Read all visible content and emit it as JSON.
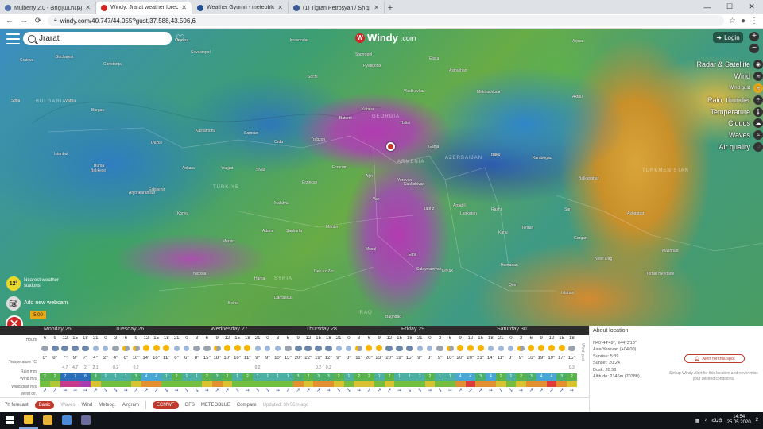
{
  "browser": {
    "tabs": [
      {
        "title": "Mulberry 2.0 - Յոցլաւություն",
        "color": "#5470a8",
        "active": false
      },
      {
        "title": "Windy: Jrarat weather forecast",
        "color": "#d02323",
        "active": true
      },
      {
        "title": "Weather Gyumri - meteoblue",
        "color": "#1e4e8c",
        "active": false
      },
      {
        "title": "(1) Tigran Petrosyan / Տիգրան",
        "color": "#3b5998",
        "active": false
      }
    ],
    "new_tab": "+",
    "url": "windy.com/40.747/44.055?gust,37.588,43.506,6"
  },
  "map": {
    "search_value": "Jrarat",
    "brand": "Windy",
    "brand_suffix": ".com",
    "login_label": "Login",
    "zoom_in": "+",
    "zoom_out": "−",
    "layers": [
      {
        "label": "Radar & Satellite",
        "selected": false,
        "small": false
      },
      {
        "label": "Wind",
        "selected": false,
        "small": false
      },
      {
        "label": "Wind gust",
        "selected": true,
        "small": true
      },
      {
        "label": "Rain, thunder",
        "selected": false,
        "small": false
      },
      {
        "label": "Temperature",
        "selected": false,
        "small": false
      },
      {
        "label": "Clouds",
        "selected": false,
        "small": false
      },
      {
        "label": "Waves",
        "selected": false,
        "small": false
      },
      {
        "label": "Air quality",
        "selected": false,
        "small": false
      }
    ],
    "countries": [
      {
        "name": "GEORGIA"
      },
      {
        "name": "AZERBAIJAN"
      },
      {
        "name": "TÜRKIYE"
      },
      {
        "name": "SYRIA"
      },
      {
        "name": "IRAQ"
      },
      {
        "name": "TURKMENISTAN"
      },
      {
        "name": "BULGARIA"
      },
      {
        "name": "ARMENIA"
      }
    ],
    "places": [
      "Craiova",
      "Bucharest",
      "Constanța",
      "Odessa",
      "Sevastopol",
      "Krasnodar",
      "Stavropol",
      "Elista",
      "Astrakhan",
      "Atyrau",
      "Sofia",
      "Varna",
      "Burgas",
      "Sochi",
      "Vladikavkaz",
      "Pyatigorsk",
      "Makhachkala",
      "Aktau",
      "Kutaisi",
      "Tbilisi",
      "Ganja",
      "Baku",
      "Istanbul",
      "Bursa",
      "Balıkesir",
      "Düzce",
      "Kastamonu",
      "Samsun",
      "Ordu",
      "Trabzon",
      "Batumi",
      "Yozgat",
      "Sivas",
      "Ankara",
      "Eskişehir",
      "Erzurum",
      "Ağrı",
      "Yerevan",
      "Erzincan",
      "Nakhchivan",
      "Lankaran",
      "Afyonkarahisar",
      "Konya",
      "Malatya",
      "Van",
      "Tabriz",
      "Ardabil",
      "Rasht",
      "Tehran",
      "Karaj",
      "Sari",
      "Mersin",
      "Adana",
      "Şanlıurfa",
      "Mardin",
      "Mosul",
      "Erbil",
      "Sulaymaniyah",
      "Kirkuk",
      "Hamadan",
      "Qom",
      "Nicosia",
      "Hama",
      "Deir ez-Zor",
      "Beirut",
      "Damascus",
      "Baghdad",
      "Isfahan",
      "Ashgabat",
      "Balkanabat",
      "Gorgan",
      "Mashhad",
      "Nebit Dag",
      "Karabogaz",
      "Torbat Heydarie"
    ],
    "temp_badge": "12°",
    "stations_label": "Nearest weather stations",
    "webcam_label": "Add new webcam",
    "time_badge": "5:00"
  },
  "forecast": {
    "days": [
      "Monday 25",
      "Tuesday 26",
      "Wednesday 27",
      "Thursday 28",
      "Friday 29",
      "Saturday 30"
    ],
    "row_labels": [
      "Hours",
      "Temperature",
      "Rain",
      "Wind",
      "Wind gust",
      "Wind dir."
    ],
    "units": [
      "",
      "°C",
      "mm",
      "m/s",
      "m/s",
      ""
    ],
    "scroll_label": "Wind gust",
    "hours": [
      "6",
      "9",
      "12",
      "15",
      "18",
      "21",
      "0",
      "3",
      "6",
      "9",
      "12",
      "15",
      "18",
      "21",
      "0",
      "3",
      "6",
      "9",
      "12",
      "15",
      "18",
      "21",
      "0",
      "3",
      "6",
      "9",
      "12",
      "15",
      "18",
      "21",
      "0",
      "3",
      "6",
      "9",
      "12",
      "15",
      "18",
      "21",
      "0",
      "3",
      "6",
      "9",
      "12",
      "15",
      "18",
      "21",
      "0",
      "3",
      "6",
      "9",
      "12",
      "15",
      "18"
    ],
    "icons": [
      "cloud",
      "rain",
      "rain",
      "rain",
      "rain",
      "moon",
      "moon",
      "cloud",
      "pc",
      "pc",
      "sun",
      "sun",
      "sun",
      "moon",
      "moon",
      "cloud",
      "cloud",
      "pc",
      "sun",
      "sun",
      "sun",
      "moon",
      "moon",
      "moon",
      "cloud",
      "rain",
      "rain",
      "rain",
      "rain",
      "moon",
      "moon",
      "pc",
      "sun",
      "sun",
      "rain",
      "rain",
      "rain",
      "moon",
      "moon",
      "cloud",
      "pc",
      "sun",
      "sun",
      "sun",
      "moon",
      "moon",
      "moon",
      "pc",
      "sun",
      "sun",
      "sun",
      "sun",
      "cloud"
    ],
    "temps": [
      "6°",
      "8°",
      "7°",
      "9°",
      "7°",
      "4°",
      "2°",
      "4°",
      "6°",
      "10°",
      "14°",
      "16°",
      "11°",
      "6°",
      "6°",
      "8°",
      "15°",
      "18°",
      "18°",
      "16°",
      "11°",
      "9°",
      "9°",
      "10°",
      "15°",
      "20°",
      "22°",
      "19°",
      "12°",
      "9°",
      "8°",
      "11°",
      "20°",
      "23°",
      "20°",
      "19°",
      "15°",
      "9°",
      "8°",
      "9°",
      "16°",
      "20°",
      "20°",
      "21°",
      "14°",
      "11°",
      "8°",
      "9°",
      "16°",
      "19°",
      "19°",
      "17°",
      "15°"
    ],
    "rain": [
      "",
      "",
      "4.7",
      "4.7",
      "2",
      "2.1",
      "",
      "0.2",
      "",
      "0.2",
      "",
      "",
      "",
      "",
      "",
      "",
      "",
      "",
      "",
      "",
      "",
      "0.2",
      "",
      "",
      "",
      "",
      "",
      "0.2",
      "0.2",
      "",
      "",
      "",
      "",
      "",
      "",
      "",
      "",
      "",
      "",
      "",
      "",
      "",
      "",
      "",
      "",
      "",
      "",
      "",
      "",
      "",
      "",
      "",
      "0.3"
    ],
    "wind": [
      "2",
      "2",
      "7",
      "7",
      "8",
      "3",
      "1",
      "1",
      "1",
      "3",
      "4",
      "4",
      "1",
      "2",
      "1",
      "1",
      "2",
      "3",
      "2",
      "1",
      "2",
      "1",
      "1",
      "1",
      "1",
      "3",
      "2",
      "3",
      "3",
      "2",
      "1",
      "2",
      "2",
      "1",
      "2",
      "1",
      "1",
      "1",
      "2",
      "1",
      "1",
      "4",
      "4",
      "3",
      "4",
      "2",
      "1",
      "2",
      "3",
      "4",
      "4",
      "3",
      "2"
    ],
    "wind_colors": [
      "#5ab34c",
      "#5ab34c",
      "#2c6fb7",
      "#2c6fb7",
      "#2c6fb7",
      "#4eae6e",
      "#4eb0a2",
      "#4eb0a2",
      "#4eb0a2",
      "#4eae6e",
      "#4aa6d4",
      "#4aa6d4",
      "#4eb0a2",
      "#5ab34c",
      "#4eb0a2",
      "#4eb0a2",
      "#5ab34c",
      "#4eae6e",
      "#5ab34c",
      "#4eb0a2",
      "#5ab34c",
      "#4eb0a2",
      "#4eb0a2",
      "#4eb0a2",
      "#4eb0a2",
      "#4eae6e",
      "#5ab34c",
      "#4eae6e",
      "#4eae6e",
      "#5ab34c",
      "#4eb0a2",
      "#5ab34c",
      "#5ab34c",
      "#4eb0a2",
      "#5ab34c",
      "#4eb0a2",
      "#4eb0a2",
      "#4eb0a2",
      "#5ab34c",
      "#4eb0a2",
      "#4eb0a2",
      "#4aa6d4",
      "#4aa6d4",
      "#4eae6e",
      "#4aa6d4",
      "#5ab34c",
      "#4eb0a2",
      "#5ab34c",
      "#4eae6e",
      "#4aa6d4",
      "#4aa6d4",
      "#4eae6e",
      "#5ab34c"
    ],
    "gust_colors": [
      "#74bf3f",
      "#b0c838",
      "#c83a8e",
      "#c83a8e",
      "#a93cb0",
      "#d8c232",
      "#74bf3f",
      "#74bf3f",
      "#74bf3f",
      "#d8c232",
      "#e39030",
      "#e39030",
      "#74bf3f",
      "#74bf3f",
      "#74bf3f",
      "#74bf3f",
      "#d8c232",
      "#e39030",
      "#d8c232",
      "#74bf3f",
      "#74bf3f",
      "#74bf3f",
      "#74bf3f",
      "#74bf3f",
      "#74bf3f",
      "#e39030",
      "#d8c232",
      "#e39030",
      "#e39030",
      "#d8c232",
      "#74bf3f",
      "#d8c232",
      "#d8c232",
      "#74bf3f",
      "#d8c232",
      "#74bf3f",
      "#74bf3f",
      "#74bf3f",
      "#d8c232",
      "#74bf3f",
      "#74bf3f",
      "#e39030",
      "#e03c3c",
      "#e39030",
      "#e39030",
      "#d8c232",
      "#74bf3f",
      "#d8c232",
      "#e39030",
      "#e39030",
      "#e03c3c",
      "#e39030",
      "#d8c232"
    ],
    "dirs": [
      "➚",
      "➚",
      "➙",
      "➙",
      "➙",
      "➚",
      "➘",
      "➘",
      "➙",
      "➚",
      "➚",
      "➚",
      "➘",
      "➙",
      "➘",
      "➘",
      "➙",
      "➚",
      "➚",
      "➘",
      "➙",
      "➘",
      "➘",
      "➙",
      "➚",
      "➚",
      "➚",
      "➚",
      "➙",
      "➘",
      "➘",
      "➙",
      "➚",
      "➚",
      "➚",
      "➙",
      "➘",
      "➘",
      "➙",
      "➘",
      "➙",
      "➚",
      "➚",
      "➚",
      "➙",
      "➘",
      "➘",
      "➙",
      "➚",
      "➚",
      "➚",
      "➚",
      "➙"
    ],
    "models_bar": {
      "tomorrow": "7h forecast",
      "basic": "Basic",
      "waves": "Waves",
      "wind": "Wind",
      "meteogram": "Meteog.",
      "airgram": "Airgram",
      "ecmwf": "ECMWF",
      "gfs": "GFS",
      "meteoblue": "METEOBLUE",
      "compare": "Compare",
      "updated": "Updated: 3h 56m ago"
    }
  },
  "about": {
    "title": "About location",
    "lines": [
      "N40°44'49\", E44°3'18\"",
      "Asia/Yerevan (+04:00)",
      "Sunrise: 5:39",
      "Sunset: 20:24",
      "Dusk: 20:56",
      "Altitude: 2146m (7038ft)"
    ],
    "alert_label": "Alert for this spot",
    "alert_desc": "Set up Windy Alert for this location and never miss your desired conditions."
  },
  "taskbar": {
    "apps": [
      {
        "name": "chrome",
        "color": "#f2c230",
        "active": true
      },
      {
        "name": "explorer",
        "color": "#e8b23a",
        "active": false
      },
      {
        "name": "media",
        "color": "#4a8ad8",
        "active": false
      },
      {
        "name": "app",
        "color": "#6c6c9e",
        "active": false
      }
    ],
    "lang": "ՀԱՅ",
    "time": "14:54",
    "date": "25.05.2020",
    "notif": "2"
  }
}
